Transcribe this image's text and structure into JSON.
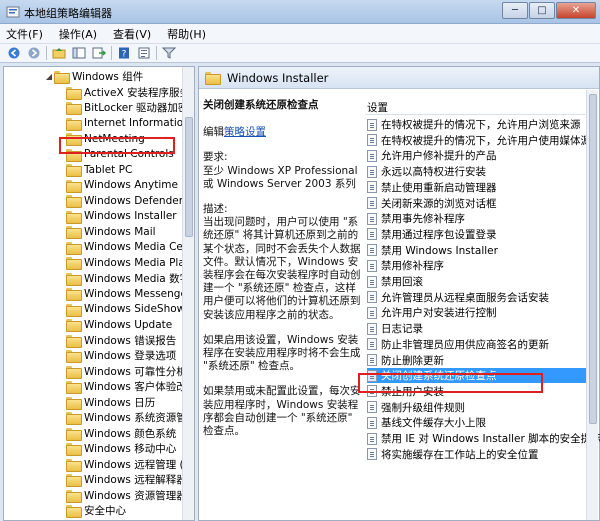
{
  "window": {
    "title": "本地组策略编辑器",
    "minimize": "─",
    "maximize": "□",
    "close": "✕"
  },
  "menu": {
    "file": "文件(F)",
    "action": "操作(A)",
    "view": "查看(V)",
    "help": "帮助(H)"
  },
  "toolbar": {
    "icons": [
      "back-icon",
      "forward-icon",
      "up-icon",
      "show-tree-icon",
      "export-icon",
      "help-icon",
      "properties-icon",
      "filter-icon"
    ]
  },
  "tree": {
    "items": [
      {
        "label": "Windows 组件",
        "expanded": true
      },
      {
        "label": "ActiveX 安装程序服务"
      },
      {
        "label": "BitLocker 驱动器加密"
      },
      {
        "label": "Internet Information"
      },
      {
        "label": "NetMeeting"
      },
      {
        "label": "Parental Controls"
      },
      {
        "label": "Tablet PC"
      },
      {
        "label": "Windows Anytime Up"
      },
      {
        "label": "Windows Defender"
      },
      {
        "label": "Windows Installer",
        "selected": true
      },
      {
        "label": "Windows Mail"
      },
      {
        "label": "Windows Media Cen"
      },
      {
        "label": "Windows Media Play"
      },
      {
        "label": "Windows Media 数字"
      },
      {
        "label": "Windows Messenger"
      },
      {
        "label": "Windows SideShow"
      },
      {
        "label": "Windows Update"
      },
      {
        "label": "Windows 错误报告"
      },
      {
        "label": "Windows 登录选项"
      },
      {
        "label": "Windows 可靠性分析"
      },
      {
        "label": "Windows 客户体验改进"
      },
      {
        "label": "Windows 日历"
      },
      {
        "label": "Windows 系统资源管理"
      },
      {
        "label": "Windows 颜色系统"
      },
      {
        "label": "Windows 移动中心"
      },
      {
        "label": "Windows 远程管理 (V"
      },
      {
        "label": "Windows 远程解释器"
      },
      {
        "label": "Windows 资源管理器"
      },
      {
        "label": "安全中心"
      }
    ]
  },
  "panel": {
    "title": "Windows Installer",
    "description": {
      "policy_title": "关闭创建系统还原检查点",
      "edit_prefix": "编辑",
      "edit_link": "策略设置",
      "req_label": "要求:",
      "req_text": "至少 Windows XP Professional 或 Windows Server 2003 系列",
      "desc_label": "描述:",
      "desc_text": "当出现问题时，用户可以使用 \"系统还原\" 将其计算机还原到之前的某个状态，同时不会丢失个人数据文件。默认情况下，Windows 安装程序会在每次安装程序时自动创建一个 \"系统还原\" 检查点，这样用户便可以将他们的计算机还原到安装该应用程序之前的状态。",
      "enabled_text": "如果启用该设置，Windows 安装程序在安装应用程序时将不会生成 \"系统还原\" 检查点。",
      "disabled_text": "如果禁用或未配置此设置，每次安装应用程序时，Windows 安装程序都会自动创建一个 \"系统还原\" 检查点。"
    },
    "settings_header": "设置",
    "settings": [
      {
        "label": "在特权被提升的情况下，允许用户浏览来源"
      },
      {
        "label": "在特权被提升的情况下，允许用户使用媒体源"
      },
      {
        "label": "允许用户修补提升的产品"
      },
      {
        "label": "永远以高特权进行安装"
      },
      {
        "label": "禁止使用重新启动管理器"
      },
      {
        "label": "关闭新来源的浏览对话框"
      },
      {
        "label": "禁用事先修补程序"
      },
      {
        "label": "禁用通过程序包设置登录"
      },
      {
        "label": "禁用 Windows Installer"
      },
      {
        "label": "禁用修补程序"
      },
      {
        "label": "禁用回滚"
      },
      {
        "label": "允许管理员从远程桌面服务会话安装"
      },
      {
        "label": "允许用户对安装进行控制"
      },
      {
        "label": "日志记录"
      },
      {
        "label": "防止非管理员应用供应商签名的更新"
      },
      {
        "label": "防止删除更新"
      },
      {
        "label": "关闭创建系统还原检查点",
        "selected": true
      },
      {
        "label": "禁止用户安装"
      },
      {
        "label": "强制升级组件规则"
      },
      {
        "label": "基线文件缓存大小上限"
      },
      {
        "label": "禁用 IE 对 Windows Installer 脚本的安全提示"
      },
      {
        "label": "将实施缓存在工作站上的安全位置"
      }
    ]
  }
}
